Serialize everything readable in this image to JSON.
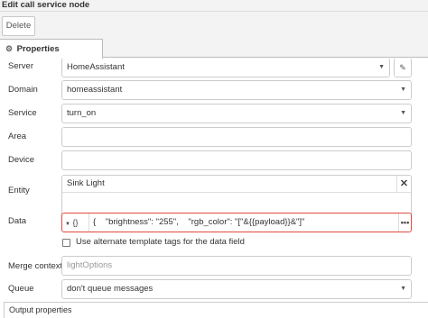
{
  "window": {
    "title": "Edit call service node"
  },
  "toolbar": {
    "delete_label": "Delete"
  },
  "tabs": [
    {
      "label": "Properties",
      "icon": "gear-icon"
    }
  ],
  "form": {
    "server": {
      "label": "Server",
      "value": "HomeAssistant",
      "edit_icon": "pencil-icon"
    },
    "domain": {
      "label": "Domain",
      "value": "homeassistant"
    },
    "service": {
      "label": "Service",
      "value": "turn_on"
    },
    "area": {
      "label": "Area",
      "value": ""
    },
    "device": {
      "label": "Device",
      "value": ""
    },
    "entity": {
      "label": "Entity",
      "chip": "Sink Light",
      "remove_glyph": "✕"
    },
    "data": {
      "label": "Data",
      "type_glyph": "{}",
      "value": "{    \"brightness\": \"255\",    \"rgb_color\": \"[\"&{{payload}}&\"]\"",
      "expand_glyph": "•••"
    },
    "alt_tags": {
      "label": "Use alternate template tags for the data field",
      "checked": false
    },
    "merge_context": {
      "label": "Merge context",
      "placeholder": "lightOptions"
    },
    "queue": {
      "label": "Queue",
      "value": "don't queue messages"
    },
    "output_properties": {
      "label": "Output properties"
    }
  },
  "colors": {
    "error_border": "#e04a3f",
    "chrome": "#f3f3f3"
  }
}
